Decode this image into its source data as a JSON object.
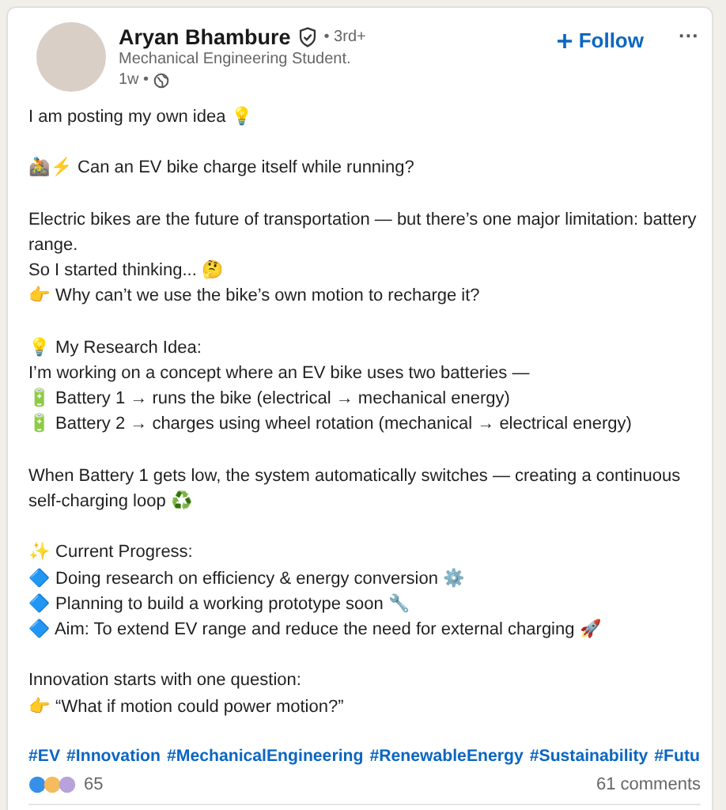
{
  "author": {
    "name": "Aryan Bhambure",
    "verified": true,
    "degree": "• 3rd+",
    "headline": "Mechanical Engineering Student.",
    "time": "1w •"
  },
  "follow": "Follow",
  "more": "···",
  "paragraphs": [
    [
      {
        "text": "I am posting my own idea 💡"
      }
    ],
    [
      {
        "text": "🚵⚡ Can an EV bike charge itself while running?"
      }
    ],
    [
      {
        "text": "Electric bikes are the future of transportation — but there’s one major limitation: battery range."
      },
      {
        "text": "So I started thinking... 🤔"
      },
      {
        "text": "👉 Why can’t we use the bike’s own motion to recharge it?"
      }
    ],
    [
      {
        "text": "💡 My Research Idea:"
      },
      {
        "text": "I’m working on a concept where an EV bike uses two batteries —"
      },
      {
        "text": "🔋 Battery 1 → runs the bike (electrical → mechanical energy)"
      },
      {
        "text": "🔋 Battery 2 → charges using wheel rotation (mechanical → electrical energy)"
      }
    ],
    [
      {
        "text": "When Battery 1 gets low, the system automatically switches — creating a continuous self-charging loop ♻️"
      }
    ],
    [
      {
        "text": "✨ Current Progress:"
      },
      {
        "text": "🔷 Doing research on efficiency & energy conversion ⚙️"
      },
      {
        "text": "🔷 Planning to build a working prototype soon 🔧"
      },
      {
        "text": "🔷 Aim: To extend EV range and reduce the need for external charging 🚀"
      }
    ],
    [
      {
        "text": "Innovation starts with one question:"
      },
      {
        "text": "👉 “What if motion could power motion?”"
      }
    ]
  ],
  "hashtags": [
    "#EV",
    "#Innovation",
    "#MechanicalEngineering",
    "#RenewableEnergy",
    "#Sustainability",
    "#Futu"
  ],
  "reactions": "65",
  "comments": "61 comments"
}
